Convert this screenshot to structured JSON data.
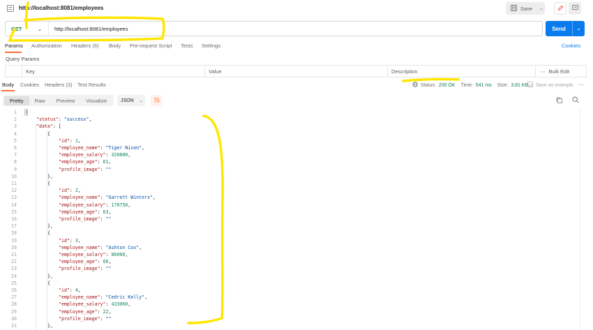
{
  "tab": {
    "title": "http://localhost:8081/employees"
  },
  "toolbar": {
    "save_label": "Save"
  },
  "request": {
    "method": "GET",
    "url": "http://localhost:8081/employees",
    "send_label": "Send"
  },
  "request_tabs": [
    "Params",
    "Authorization",
    "Headers (6)",
    "Body",
    "Pre-request Script",
    "Tests",
    "Settings"
  ],
  "cookies_label": "Cookies",
  "query_params": {
    "title": "Query Params",
    "columns": {
      "key": "Key",
      "value": "Value",
      "description": "Description",
      "bulk_edit": "Bulk Edit"
    }
  },
  "response_tabs": [
    "Body",
    "Cookies",
    "Headers (3)",
    "Test Results"
  ],
  "response_meta": {
    "status_label": "Status:",
    "status_value": "200 OK",
    "time_label": "Time:",
    "time_value": "541 ms",
    "size_label": "Size:",
    "size_value": "3.81 KB",
    "save_example": "Save as example"
  },
  "view_modes": [
    "Pretty",
    "Raw",
    "Preview",
    "Visualize"
  ],
  "format": "JSON",
  "code_lines": [
    {
      "n": "1",
      "indent": 0,
      "parts": [
        [
          "p",
          "{"
        ]
      ]
    },
    {
      "n": "2",
      "indent": 1,
      "parts": [
        [
          "k",
          "\"status\""
        ],
        [
          "p",
          ": "
        ],
        [
          "s",
          "\"success\""
        ],
        [
          "p",
          ","
        ]
      ]
    },
    {
      "n": "3",
      "indent": 1,
      "parts": [
        [
          "k",
          "\"data\""
        ],
        [
          "p",
          ": ["
        ]
      ]
    },
    {
      "n": "4",
      "indent": 2,
      "parts": [
        [
          "p",
          "{"
        ]
      ]
    },
    {
      "n": "5",
      "indent": 3,
      "parts": [
        [
          "k",
          "\"id\""
        ],
        [
          "p",
          ": "
        ],
        [
          "n",
          "1"
        ],
        [
          "p",
          ","
        ]
      ]
    },
    {
      "n": "6",
      "indent": 3,
      "parts": [
        [
          "k",
          "\"employee_name\""
        ],
        [
          "p",
          ": "
        ],
        [
          "s",
          "\"Tiger Nixon\""
        ],
        [
          "p",
          ","
        ]
      ]
    },
    {
      "n": "7",
      "indent": 3,
      "parts": [
        [
          "k",
          "\"employee_salary\""
        ],
        [
          "p",
          ": "
        ],
        [
          "n",
          "320800"
        ],
        [
          "p",
          ","
        ]
      ]
    },
    {
      "n": "8",
      "indent": 3,
      "parts": [
        [
          "k",
          "\"employee_age\""
        ],
        [
          "p",
          ": "
        ],
        [
          "n",
          "61"
        ],
        [
          "p",
          ","
        ]
      ]
    },
    {
      "n": "9",
      "indent": 3,
      "parts": [
        [
          "k",
          "\"profile_image\""
        ],
        [
          "p",
          ": "
        ],
        [
          "s",
          "\"\""
        ]
      ]
    },
    {
      "n": "10",
      "indent": 2,
      "parts": [
        [
          "p",
          "},"
        ]
      ]
    },
    {
      "n": "11",
      "indent": 2,
      "parts": [
        [
          "p",
          "{"
        ]
      ]
    },
    {
      "n": "12",
      "indent": 3,
      "parts": [
        [
          "k",
          "\"id\""
        ],
        [
          "p",
          ": "
        ],
        [
          "n",
          "2"
        ],
        [
          "p",
          ","
        ]
      ]
    },
    {
      "n": "13",
      "indent": 3,
      "parts": [
        [
          "k",
          "\"employee_name\""
        ],
        [
          "p",
          ": "
        ],
        [
          "s",
          "\"Garrett Winters\""
        ],
        [
          "p",
          ","
        ]
      ]
    },
    {
      "n": "14",
      "indent": 3,
      "parts": [
        [
          "k",
          "\"employee_salary\""
        ],
        [
          "p",
          ": "
        ],
        [
          "n",
          "170750"
        ],
        [
          "p",
          ","
        ]
      ]
    },
    {
      "n": "15",
      "indent": 3,
      "parts": [
        [
          "k",
          "\"employee_age\""
        ],
        [
          "p",
          ": "
        ],
        [
          "n",
          "63"
        ],
        [
          "p",
          ","
        ]
      ]
    },
    {
      "n": "16",
      "indent": 3,
      "parts": [
        [
          "k",
          "\"profile_image\""
        ],
        [
          "p",
          ": "
        ],
        [
          "s",
          "\"\""
        ]
      ]
    },
    {
      "n": "17",
      "indent": 2,
      "parts": [
        [
          "p",
          "},"
        ]
      ]
    },
    {
      "n": "18",
      "indent": 2,
      "parts": [
        [
          "p",
          "{"
        ]
      ]
    },
    {
      "n": "19",
      "indent": 3,
      "parts": [
        [
          "k",
          "\"id\""
        ],
        [
          "p",
          ": "
        ],
        [
          "n",
          "3"
        ],
        [
          "p",
          ","
        ]
      ]
    },
    {
      "n": "20",
      "indent": 3,
      "parts": [
        [
          "k",
          "\"employee_name\""
        ],
        [
          "p",
          ": "
        ],
        [
          "s",
          "\"Ashton Cox\""
        ],
        [
          "p",
          ","
        ]
      ]
    },
    {
      "n": "21",
      "indent": 3,
      "parts": [
        [
          "k",
          "\"employee_salary\""
        ],
        [
          "p",
          ": "
        ],
        [
          "n",
          "86000"
        ],
        [
          "p",
          ","
        ]
      ]
    },
    {
      "n": "22",
      "indent": 3,
      "parts": [
        [
          "k",
          "\"employee_age\""
        ],
        [
          "p",
          ": "
        ],
        [
          "n",
          "66"
        ],
        [
          "p",
          ","
        ]
      ]
    },
    {
      "n": "23",
      "indent": 3,
      "parts": [
        [
          "k",
          "\"profile_image\""
        ],
        [
          "p",
          ": "
        ],
        [
          "s",
          "\"\""
        ]
      ]
    },
    {
      "n": "24",
      "indent": 2,
      "parts": [
        [
          "p",
          "},"
        ]
      ]
    },
    {
      "n": "25",
      "indent": 2,
      "parts": [
        [
          "p",
          "{"
        ]
      ]
    },
    {
      "n": "26",
      "indent": 3,
      "parts": [
        [
          "k",
          "\"id\""
        ],
        [
          "p",
          ": "
        ],
        [
          "n",
          "4"
        ],
        [
          "p",
          ","
        ]
      ]
    },
    {
      "n": "27",
      "indent": 3,
      "parts": [
        [
          "k",
          "\"employee_name\""
        ],
        [
          "p",
          ": "
        ],
        [
          "s",
          "\"Cedric Kelly\""
        ],
        [
          "p",
          ","
        ]
      ]
    },
    {
      "n": "28",
      "indent": 3,
      "parts": [
        [
          "k",
          "\"employee_salary\""
        ],
        [
          "p",
          ": "
        ],
        [
          "n",
          "433060"
        ],
        [
          "p",
          ","
        ]
      ]
    },
    {
      "n": "29",
      "indent": 3,
      "parts": [
        [
          "k",
          "\"employee_age\""
        ],
        [
          "p",
          ": "
        ],
        [
          "n",
          "22"
        ],
        [
          "p",
          ","
        ]
      ]
    },
    {
      "n": "30",
      "indent": 3,
      "parts": [
        [
          "k",
          "\"profile_image\""
        ],
        [
          "p",
          ": "
        ],
        [
          "s",
          "\"\""
        ]
      ]
    },
    {
      "n": "31",
      "indent": 2,
      "parts": [
        [
          "p",
          "},"
        ]
      ]
    }
  ],
  "colors": {
    "accent": "#097bed",
    "tab_underline": "#ff6c37",
    "method_get": "#0f7b4a",
    "json_key": "#a31515",
    "json_string": "#0451a5",
    "json_number": "#098658",
    "highlight_marker": "#ffe600"
  }
}
